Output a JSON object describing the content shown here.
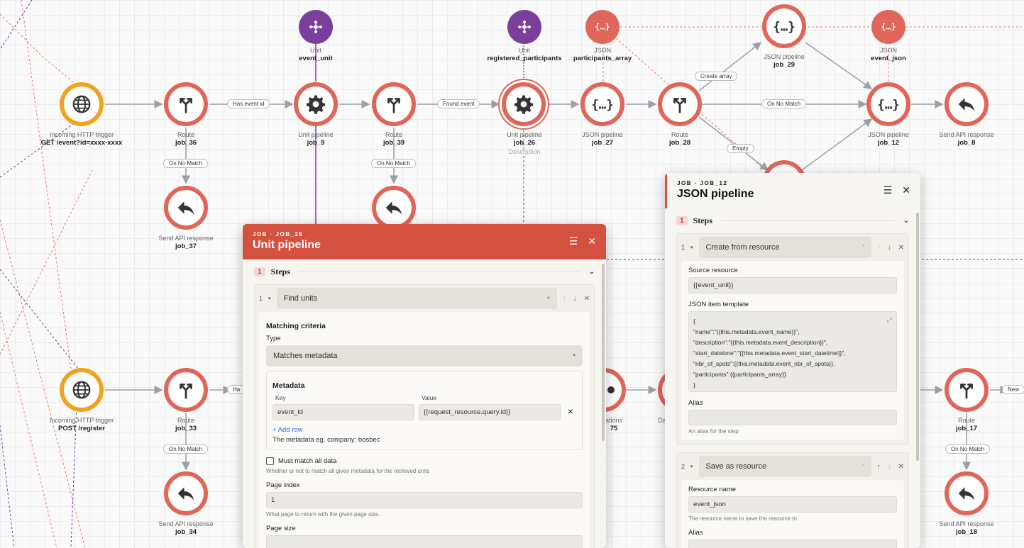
{
  "nodes": {
    "trigger_event": {
      "title": "Incoming HTTP trigger",
      "sub": "GET /event?id=xxxx-xxxx"
    },
    "job36": {
      "title": "Route",
      "sub": "job_36"
    },
    "job37": {
      "title": "Send API response",
      "sub": "job_37"
    },
    "unit_event": {
      "title": "Unit",
      "sub": "event_unit"
    },
    "job9": {
      "title": "Unit pipeline",
      "sub": "job_9"
    },
    "job39": {
      "title": "Route",
      "sub": "job_39"
    },
    "unit_reg": {
      "title": "Unit",
      "sub": "registered_participants"
    },
    "job26": {
      "title": "Unit pipeline",
      "sub": "job_26",
      "desc": "Description"
    },
    "json_participants": {
      "title": "JSON",
      "sub": "participants_array"
    },
    "job27": {
      "title": "JSON pipeline",
      "sub": "job_27"
    },
    "job28": {
      "title": "Route",
      "sub": "job_28"
    },
    "job29": {
      "title": "JSON pipeline",
      "sub": "job_29"
    },
    "json_event": {
      "title": "JSON",
      "sub": "event_json"
    },
    "job12": {
      "title": "JSON pipeline",
      "sub": "job_12"
    },
    "job8": {
      "title": "Send API response",
      "sub": "job_8"
    },
    "trigger_register": {
      "title": "Incoming HTTP trigger",
      "sub": "POST /register"
    },
    "job33": {
      "title": "Route",
      "sub": "job_33"
    },
    "job34": {
      "title": "Send API response",
      "sub": "job_34"
    },
    "job17": {
      "title": "Route",
      "sub": "job_17"
    },
    "job18": {
      "title": "Send API response",
      "sub": "job_18"
    },
    "partial_ations": {
      "title": "ations",
      "sub": "75"
    },
    "partial_da": {
      "title": "Da"
    }
  },
  "edges": {
    "has_event_id": "Has event id",
    "on_no_match_36": "On No Match",
    "on_no_match_39": "On No Match",
    "found_event": "Found event",
    "create_array": "Create array",
    "on_no_match_28": "On No Match",
    "empty": "Empty",
    "on_no_match_33": "On No Match",
    "has_partial": "Ha",
    "on_no_match_17": "On No Match",
    "new_partial": "New"
  },
  "panel_left": {
    "kicker": "JOB · JOB_26",
    "title": "Unit pipeline",
    "section_num": "1",
    "section_label": "Steps",
    "step": {
      "index": "1",
      "selected": "Find units",
      "matching_label": "Matching criteria",
      "type_label": "Type",
      "type_value": "Matches metadata",
      "metadata_label": "Metadata",
      "key_header": "Key",
      "value_header": "Value",
      "key_value": "event_id",
      "value_value": "{{request_resource.query.id}}",
      "add_row": "+ Add row",
      "metadata_hint": "The metadata eg. company: bosbec",
      "must_match_label": "Must match all data",
      "must_match_help": "Whether or not to match all given metadata for the retrieved units",
      "page_index_label": "Page index",
      "page_index_value": "1",
      "page_index_help": "What page to return with the given page size.",
      "page_size_label": "Page size"
    }
  },
  "panel_right": {
    "kicker": "JOB · JOB_12",
    "title": "JSON pipeline",
    "section_num": "1",
    "section_label": "Steps",
    "step1": {
      "index": "1",
      "selected": "Create from resource",
      "source_label": "Source resource",
      "source_value": "{{event_unit}}",
      "template_label": "JSON item template",
      "template_lines": [
        "{",
        "\"name\":\"{{this.metadata.event_name}}\",",
        "\"description\":\"{{this.metadata.event_description}}\",",
        "\"start_datetime\":\"{{this.metadata.event_start_datetime}}\",",
        "\"nbr_of_spots\":{{this.metadata.event_nbr_of_spots}},",
        "\"participants\":{{participants_array}}",
        "}"
      ],
      "alias_label": "Alias",
      "alias_placeholder": "",
      "alias_help": "An alias for the step"
    },
    "step2": {
      "index": "2",
      "selected": "Save as resource",
      "resource_name_label": "Resource name",
      "resource_name_value": "event_json",
      "resource_name_help": "The resource name to save the resource to",
      "alias_label": "Alias"
    }
  },
  "colors": {
    "node_red": "#e0665a",
    "trigger_yellow": "#efa31e",
    "unit_purple": "#7a3e9d",
    "panel_header_red": "#d4513f",
    "link_blue": "#2f6fd6"
  }
}
